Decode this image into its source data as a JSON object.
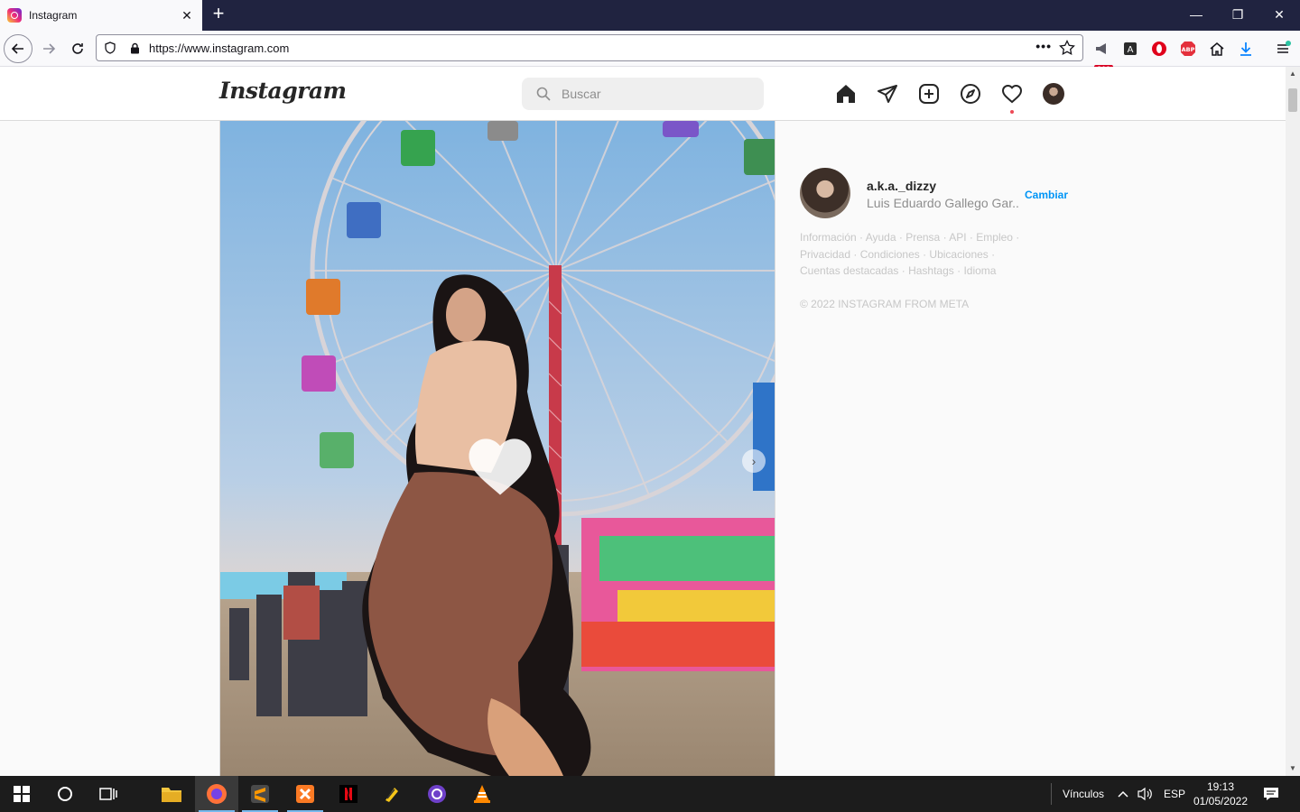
{
  "browser": {
    "tab_title": "Instagram",
    "url": "https://www.instagram.com",
    "badge_count": "210",
    "window_controls": {
      "minimize": "—",
      "maximize": "❐",
      "close": "✕"
    },
    "new_tab": "+"
  },
  "instagram": {
    "logo": "Instagram",
    "search_placeholder": "Buscar",
    "nav_icons": [
      "home-icon",
      "direct-icon",
      "new-post-icon",
      "explore-icon",
      "activity-heart-icon",
      "profile-avatar"
    ],
    "post": {
      "next_arrow": "›"
    },
    "sidebar": {
      "username": "a.k.a._dizzy",
      "full_name": "Luis Eduardo Gallego Gar...",
      "switch_label": "Cambiar",
      "footer_links": [
        "Información",
        "Ayuda",
        "Prensa",
        "API",
        "Empleo",
        "Privacidad",
        "Condiciones",
        "Ubicaciones",
        "Cuentas destacadas",
        "Hashtags",
        "Idioma"
      ],
      "separator": " · ",
      "copyright": "© 2022 INSTAGRAM FROM META"
    }
  },
  "taskbar": {
    "links_label": "Vínculos",
    "language": "ESP",
    "time": "19:13",
    "date": "01/05/2022"
  },
  "colors": {
    "tabstrip": "#202340",
    "ig_blue": "#0095f6",
    "notif_red": "#ed4956",
    "taskbar": "#1c1c1c"
  }
}
